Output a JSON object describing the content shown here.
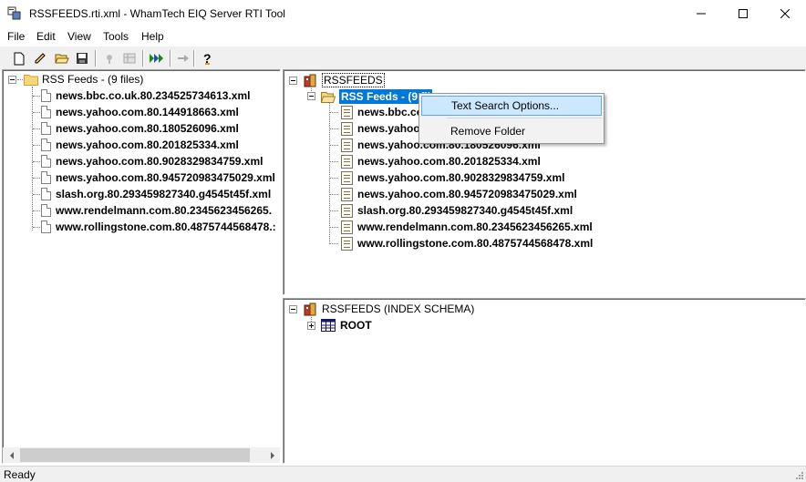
{
  "window": {
    "title": "RSSFEEDS.rti.xml - WhamTech EIQ Server RTI Tool"
  },
  "menu": [
    "File",
    "Edit",
    "View",
    "Tools",
    "Help"
  ],
  "toolbar": {
    "buttons": [
      "new-icon",
      "edit-icon",
      "open-icon",
      "save-icon",
      "tool-icon",
      "table-icon",
      "run-all-icon",
      "arrow-right-icon",
      "help-icon"
    ]
  },
  "left_tree": {
    "root_label": "RSS Feeds - (9 files)",
    "files": [
      "news.bbc.co.uk.80.234525734613.xml",
      "news.yahoo.com.80.144918663.xml",
      "news.yahoo.com.80.180526096.xml",
      "news.yahoo.com.80.201825334.xml",
      "news.yahoo.com.80.9028329834759.xml",
      "news.yahoo.com.80.945720983475029.xml",
      "slash.org.80.293459827340.g4545t45f.xml",
      "www.rendelmann.com.80.2345623456265.",
      "www.rollingstone.com.80.4875744568478.:"
    ]
  },
  "right_tree": {
    "root_label": "RSSFEEDS",
    "folder_label": "RSS Feeds - (9 fil",
    "files": [
      "news.bbc.co",
      "news.yahoo",
      "news.yahoo.com.80.180526096.xml",
      "news.yahoo.com.80.201825334.xml",
      "news.yahoo.com.80.9028329834759.xml",
      "news.yahoo.com.80.945720983475029.xml",
      "slash.org.80.293459827340.g4545t45f.xml",
      "www.rendelmann.com.80.2345623456265.xml",
      "www.rollingstone.com.80.4875744568478.xml"
    ]
  },
  "schema_tree": {
    "root_label": "RSSFEEDS (INDEX SCHEMA)",
    "child_label": "ROOT"
  },
  "context_menu": {
    "items": [
      "Text Search Options...",
      "Remove Folder"
    ]
  },
  "status": {
    "text": "Ready"
  },
  "colors": {
    "selection": "#0078d7",
    "menu_highlight": "#cce8ff",
    "folder": "#f7d779"
  }
}
